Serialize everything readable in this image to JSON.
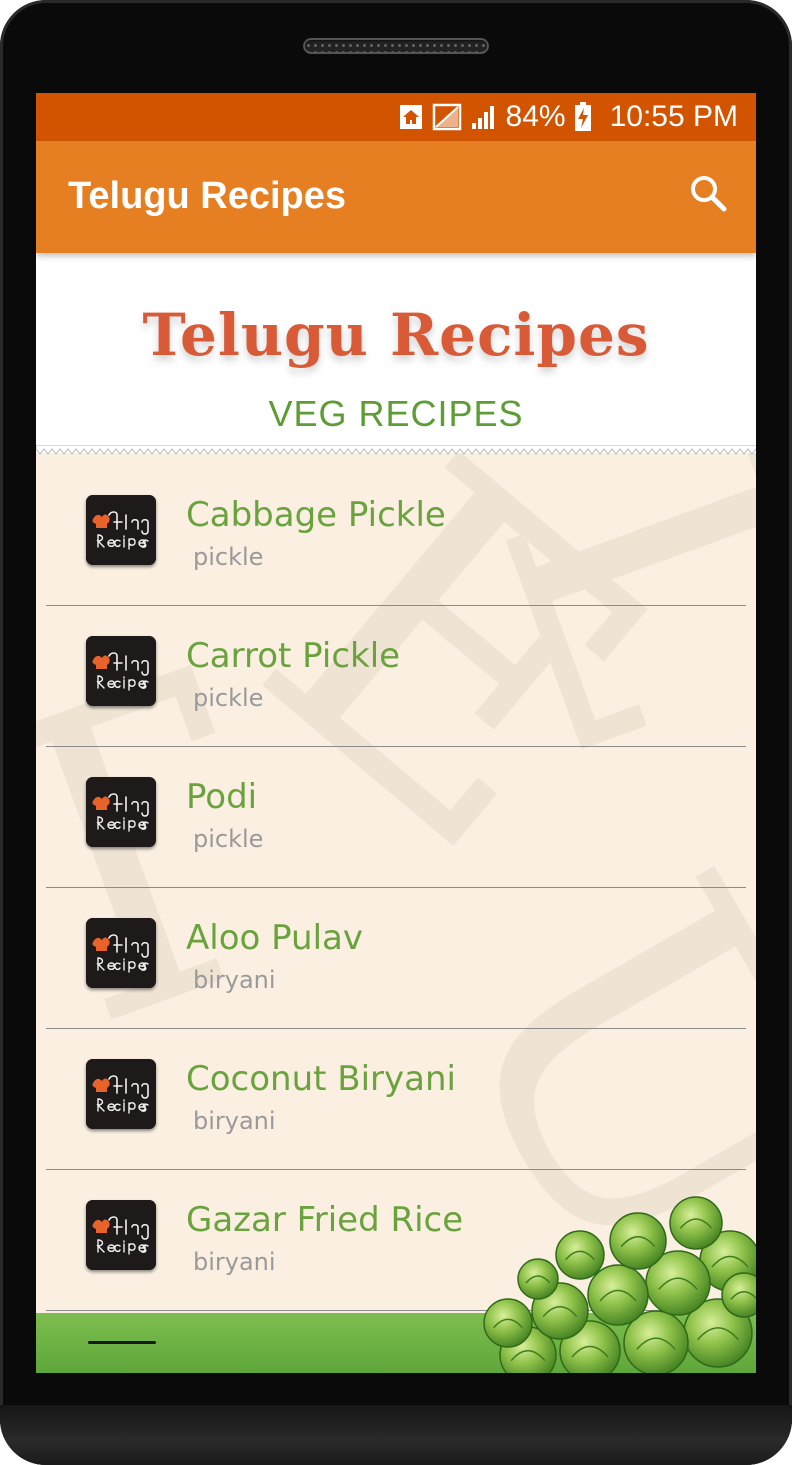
{
  "status_bar": {
    "battery": "84%",
    "time": "10:55 PM",
    "icons": [
      "home-icon",
      "no-sim-icon",
      "signal-icon",
      "battery-charging-icon"
    ]
  },
  "app_bar": {
    "title": "Telugu Recipes",
    "search_icon": "search-icon"
  },
  "banner": {
    "title": "Telugu Recipes",
    "subtitle": "VEG RECIPES"
  },
  "recipes": [
    {
      "title": "Cabbage Pickle",
      "category": "pickle"
    },
    {
      "title": "Carrot Pickle",
      "category": "pickle"
    },
    {
      "title": "Podi",
      "category": "pickle"
    },
    {
      "title": "Aloo Pulav",
      "category": "biryani"
    },
    {
      "title": "Coconut Biryani",
      "category": "biryani"
    },
    {
      "title": "Gazar Fried Rice",
      "category": "biryani"
    }
  ],
  "colors": {
    "status_bar": "#d35400",
    "app_bar": "#e67e22",
    "recipe_title": "#6aa33e",
    "banner_title": "#d85a37",
    "banner_subtitle": "#5e9c35",
    "list_background": "#faefe1"
  }
}
